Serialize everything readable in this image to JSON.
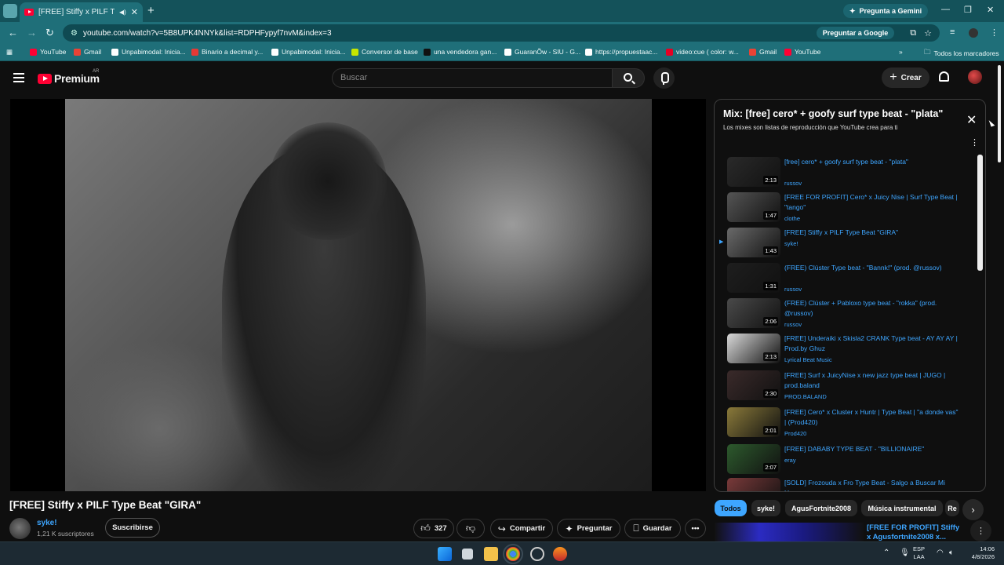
{
  "browser": {
    "tab_title": "[FREE] Stiffy x PILF Type Beat",
    "gemini": "Pregunta a Gemini",
    "url": "youtube.com/watch?v=5B8UPK4NNYk&list=RDPHFypyf7nvM&index=3",
    "omnibox_button": "Preguntar a Google",
    "bookmarks": [
      {
        "label": "YouTube",
        "color": "#ff0033"
      },
      {
        "label": "Gmail",
        "color": "#ea4335"
      },
      {
        "label": "Unpabimodal: Inicia...",
        "color": "#ffffff"
      },
      {
        "label": "Binario a decimal y...",
        "color": "#e53935"
      },
      {
        "label": "Unpabimodal: Inicia...",
        "color": "#ffffff"
      },
      {
        "label": "Conversor de base",
        "color": "#c6e600"
      },
      {
        "label": "una vendedora gan...",
        "color": "#111111"
      },
      {
        "label": "GuaranÕw - SIU - G...",
        "color": "#ffffff"
      },
      {
        "label": "https://propuestaac...",
        "color": "#ffffff"
      },
      {
        "label": "video:cue ( color: w...",
        "color": "#e60023"
      },
      {
        "label": "Gmail",
        "color": "#ea4335"
      },
      {
        "label": "YouTube",
        "color": "#ff0033"
      }
    ],
    "all_bookmarks": "Todos los marcadores"
  },
  "youtube": {
    "logo": "Premium",
    "region": "AR",
    "search_placeholder": "Buscar",
    "create": "Crear"
  },
  "video": {
    "title": "[FREE] Stiffy x PILF Type Beat \"GIRA\"",
    "channel": "syke!",
    "subscribers": "1,21 K suscriptores",
    "subscribe": "Suscribirse",
    "likes": "327",
    "share": "Compartir",
    "ask": "Preguntar",
    "save": "Guardar"
  },
  "playlist": {
    "title": "Mix: [free] cero* + goofy surf type beat - \"plata\"",
    "subtitle": "Los mixes son listas de reproducción que YouTube crea para ti",
    "items": [
      {
        "title": "[free] cero* + goofy surf type beat - \"plata\"",
        "channel": "russov",
        "duration": "2:13",
        "thumb": "#2a2a2a"
      },
      {
        "title": "[FREE FOR PROFIT] Cero* x Juicy Nise | Surf Type Beat | \"tango\"",
        "channel": "clothe",
        "duration": "1:47",
        "thumb": "#555555"
      },
      {
        "title": "[FREE] Stiffy x PILF Type Beat \"GIRA\"",
        "channel": "syke!",
        "duration": "1:43",
        "thumb": "#6a6a6a",
        "playing": true
      },
      {
        "title": "(FREE) Clúster Type beat - \"Bannk!\" (prod. @russov)",
        "channel": "russov",
        "duration": "1:31",
        "thumb": "#1e1e1e"
      },
      {
        "title": "(FREE) Clúster + Pabloxo type beat - \"rokka\" (prod. @russov)",
        "channel": "russov",
        "duration": "2:06",
        "thumb": "#4a4a4a"
      },
      {
        "title": "[FREE] Underaiki x Skisla2 CRANK Type beat - AY AY AY | Prod.by Ghuz",
        "channel": "Lyrical Beat Music",
        "duration": "2:13",
        "thumb": "#d9d9d9"
      },
      {
        "title": "[FREE] Surf x JuicyNise x new jazz type beat | JUGO | prod.baland",
        "channel": "PROD.BALAND",
        "duration": "2:30",
        "thumb": "#3a2a2a"
      },
      {
        "title": "[FREE] Cero* x Cluster x Huntr | Type Beat | \"a donde vas\" | (Prod420)",
        "channel": "Prod420",
        "duration": "2:01",
        "thumb": "#8a7a3a"
      },
      {
        "title": "[FREE] DABABY TYPE BEAT - \"BILLIONAIRE\"",
        "channel": "eray",
        "duration": "2:07",
        "thumb": "#2d5a2d"
      },
      {
        "title": "[SOLD] Frozouda x Fro Type Beat - Salgo a Buscar Mi Hueso",
        "channel": "",
        "duration": "",
        "thumb": "#7a3a3a"
      }
    ]
  },
  "chips": [
    "Todos",
    "syke!",
    "AgusFortnite2008",
    "Música instrumental",
    "Re"
  ],
  "recommended": {
    "title": "[FREE FOR PROFIT] Stiffy x Agusfortnite2008 x..."
  },
  "taskbar": {
    "lang1": "ESP",
    "lang2": "LAA",
    "time": "14:06",
    "date": "4/8/2026"
  }
}
